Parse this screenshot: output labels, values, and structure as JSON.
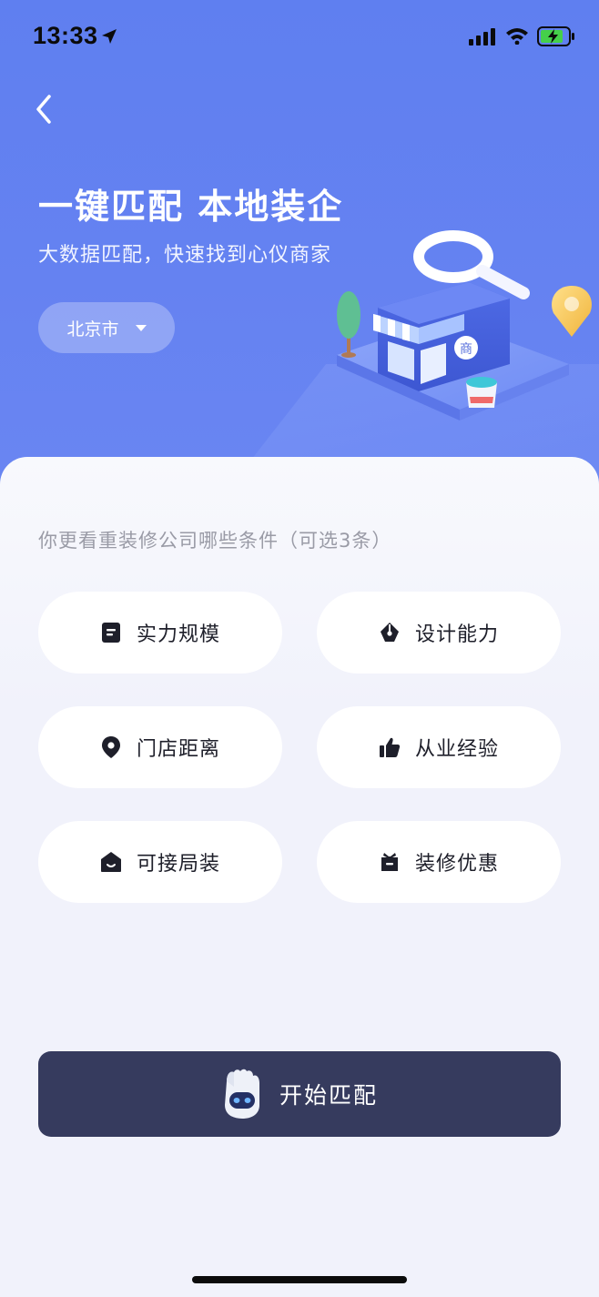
{
  "status_bar": {
    "time": "13:33",
    "icons": [
      "location-arrow-icon",
      "cellular-signal-icon",
      "wifi-icon",
      "battery-charging-icon"
    ]
  },
  "header": {
    "back_icon": "chevron-left-icon",
    "title": "一键匹配 本地装企",
    "subtitle": "大数据匹配，快速找到心仪商家",
    "city": "北京市",
    "city_icon": "caret-down-icon"
  },
  "illustration": {
    "store_badge": "商",
    "elements": [
      "store-icon",
      "magnifier-icon",
      "map-pin-icon",
      "tree-icon",
      "paint-bucket-icon"
    ]
  },
  "criteria": {
    "question": "你更看重装修公司哪些条件（可选3条）",
    "options": [
      {
        "label": "实力规模",
        "icon": "document-icon"
      },
      {
        "label": "设计能力",
        "icon": "pen-nib-icon"
      },
      {
        "label": "门店距离",
        "icon": "location-pin-icon"
      },
      {
        "label": "从业经验",
        "icon": "thumbs-up-icon"
      },
      {
        "label": "可接局装",
        "icon": "house-smile-icon"
      },
      {
        "label": "装修优惠",
        "icon": "gift-icon"
      }
    ]
  },
  "actions": {
    "start_label": "开始匹配",
    "start_icon": "robot-icon"
  },
  "colors": {
    "hero_blue": "#5f7ff0",
    "button_dark": "#363b5e",
    "background": "#f1f2fb",
    "text_dark": "#1e1f2a",
    "text_muted": "#9a9ba6"
  }
}
